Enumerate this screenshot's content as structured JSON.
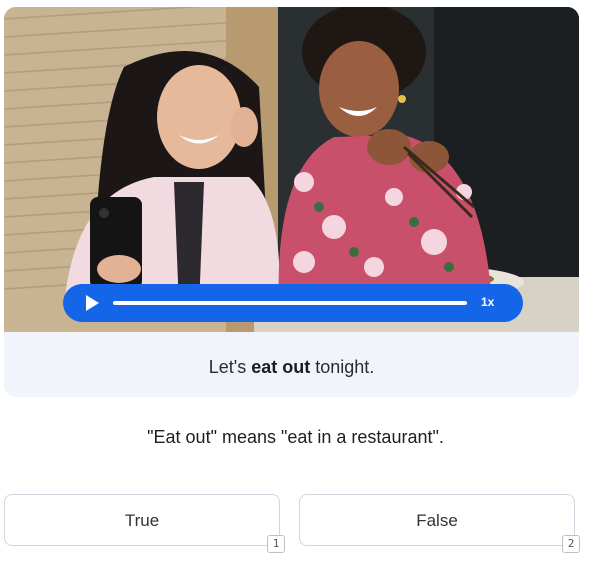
{
  "media": {
    "image_icon": "photo-two-women-taking-selfie-at-restaurant",
    "play_icon": "play-icon",
    "speed_label": "1x"
  },
  "sentence": {
    "prefix": "Let's ",
    "highlight": "eat out",
    "suffix": " tonight."
  },
  "statement": "\"Eat out\" means \"eat in a restaurant\".",
  "answers": [
    {
      "label": "True",
      "shortcut": "1"
    },
    {
      "label": "False",
      "shortcut": "2"
    }
  ],
  "colors": {
    "player": "#1565e8",
    "card_background": "#f1f4fa",
    "answer_border": "#cfd6df"
  }
}
